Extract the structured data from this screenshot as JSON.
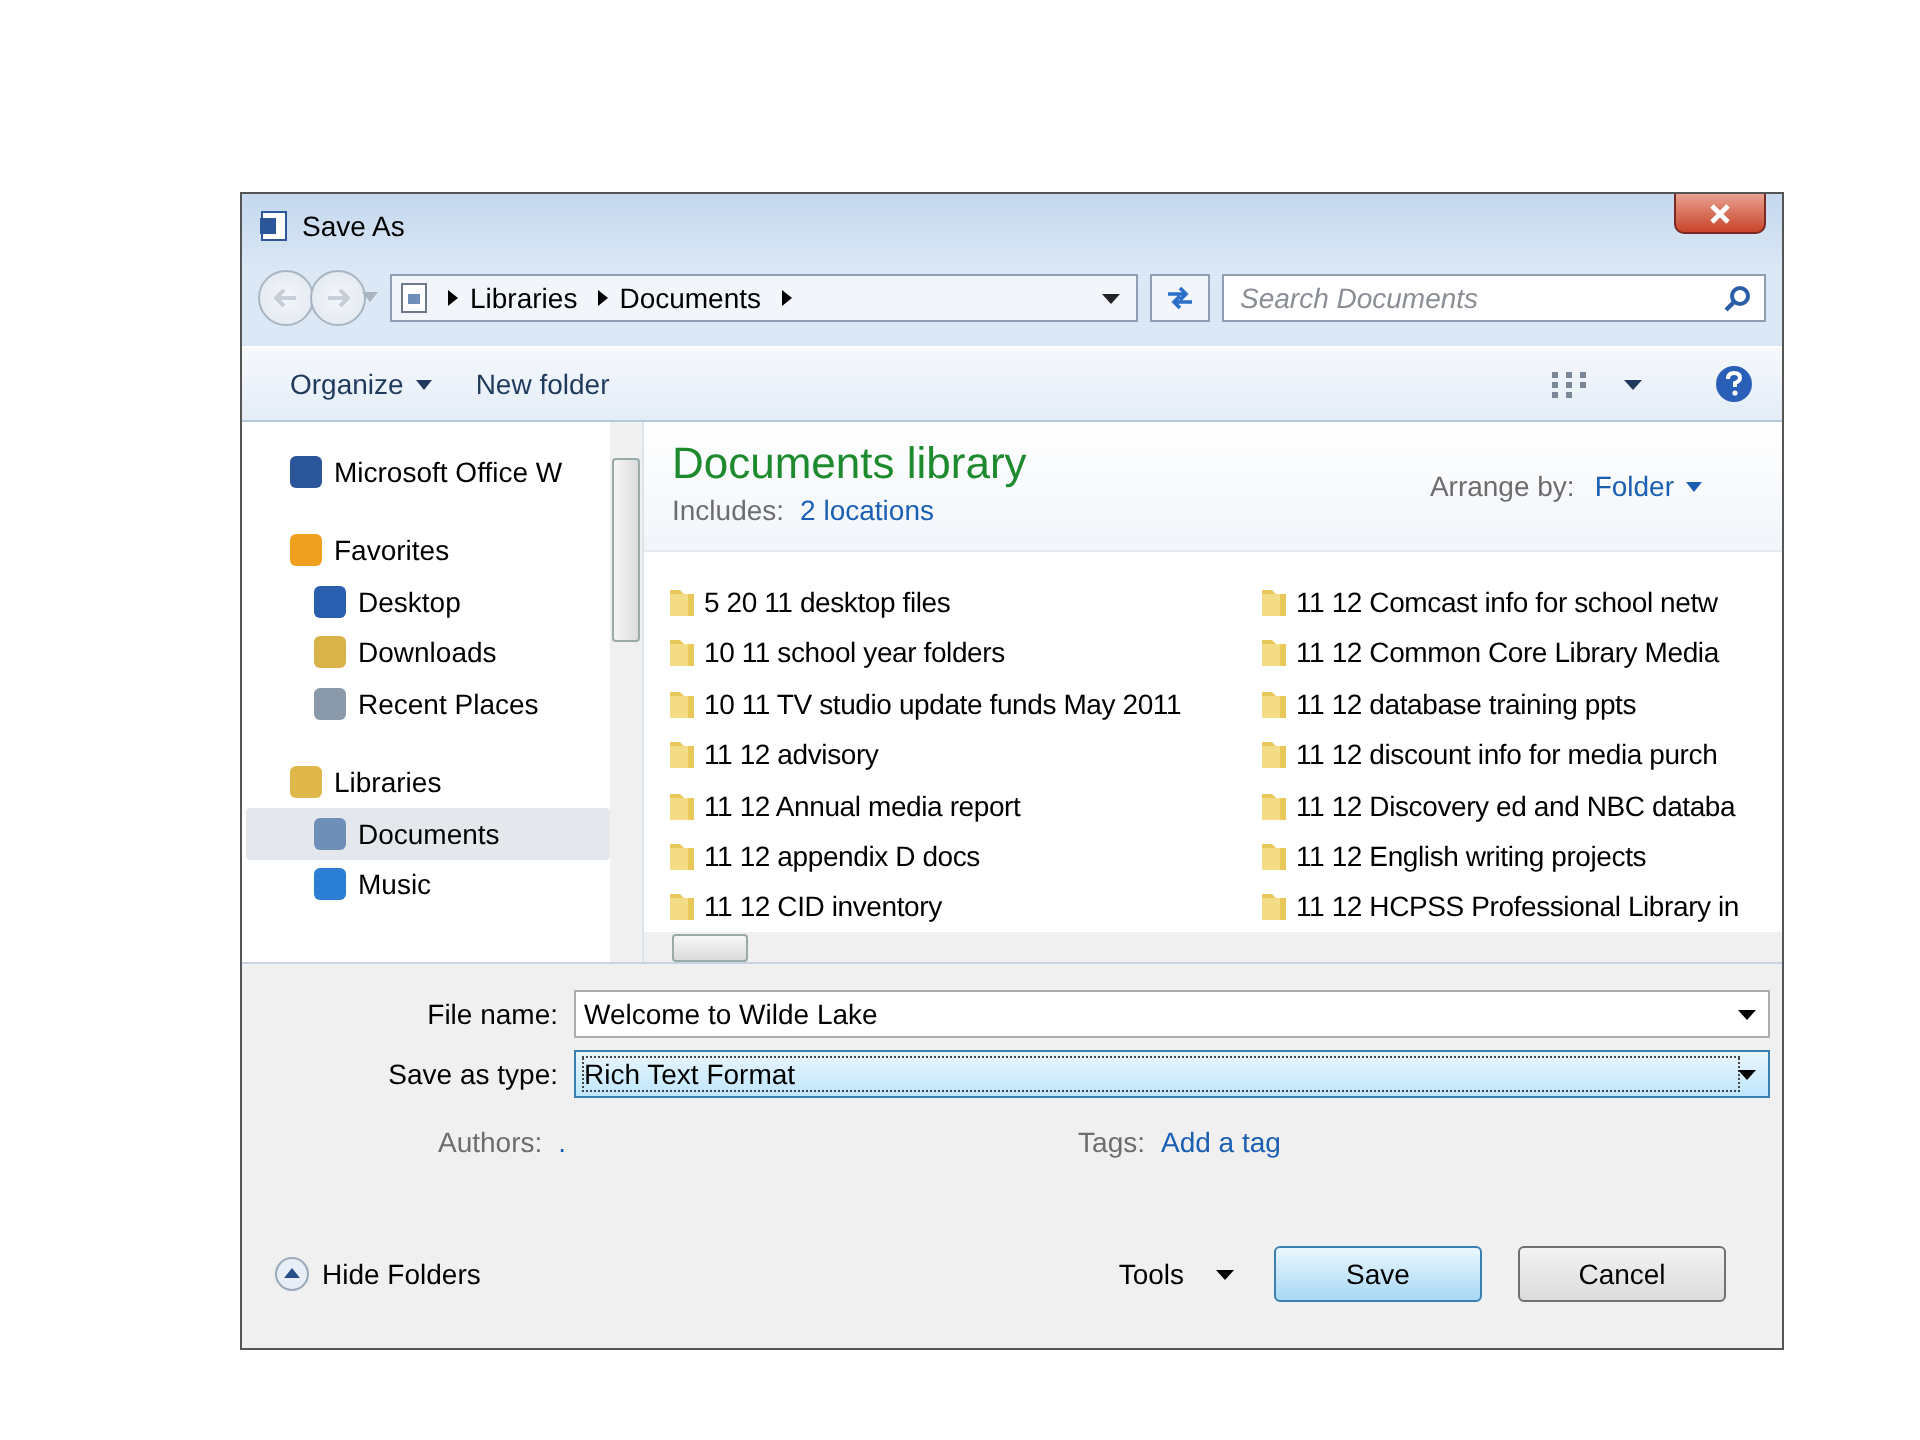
{
  "window": {
    "title": "Save As"
  },
  "navigation": {
    "breadcrumbs": [
      "Libraries",
      "Documents"
    ],
    "search": {
      "placeholder": "Search Documents"
    }
  },
  "toolbar": {
    "organize": "Organize",
    "new_folder": "New folder"
  },
  "sidebar": {
    "items": [
      {
        "label": "Microsoft Office W",
        "kind": "office",
        "selected": false
      },
      {
        "label": "Favorites",
        "kind": "favorites",
        "selected": false,
        "children": [
          {
            "label": "Desktop",
            "kind": "desktop",
            "selected": false
          },
          {
            "label": "Downloads",
            "kind": "downloads",
            "selected": false
          },
          {
            "label": "Recent Places",
            "kind": "recent",
            "selected": false
          }
        ]
      },
      {
        "label": "Libraries",
        "kind": "libraries",
        "selected": false,
        "children": [
          {
            "label": "Documents",
            "kind": "documents",
            "selected": true
          },
          {
            "label": "Music",
            "kind": "music",
            "selected": false
          }
        ]
      }
    ]
  },
  "library": {
    "title": "Documents library",
    "includes_label": "Includes:",
    "includes_link": "2 locations",
    "arrange_label": "Arrange by:",
    "arrange_value": "Folder"
  },
  "folders": [
    "5 20 11 desktop files",
    "10 11 school year folders",
    "10 11 TV studio update funds May 2011",
    "11 12 advisory",
    "11 12 Annual media report",
    "11 12 appendix D docs",
    "11 12 CID inventory",
    "11 12 Comcast info for school netw",
    "11 12 Common Core Library Media",
    "11 12 database training ppts",
    "11 12 discount info for media purch",
    "11 12 Discovery ed and NBC databa",
    "11 12 English writing projects",
    "11 12 HCPSS Professional Library in"
  ],
  "form": {
    "file_name": {
      "label": "File name:",
      "value": "Welcome to Wilde Lake"
    },
    "save_type": {
      "label": "Save as type:",
      "value": "Rich Text Format"
    },
    "authors": {
      "label": "Authors:",
      "value": "."
    },
    "tags": {
      "label": "Tags:",
      "link": "Add a tag"
    }
  },
  "footer": {
    "hide_folders": "Hide Folders",
    "tools": "Tools",
    "save": "Save",
    "cancel": "Cancel"
  }
}
